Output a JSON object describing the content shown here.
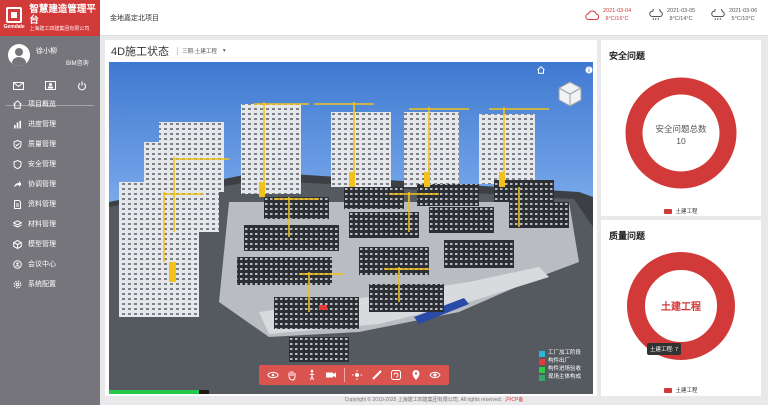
{
  "brand": {
    "title": "智慧建造管理平台",
    "subtitle": "上海建工四建集团有限公司",
    "logo_text": "Gemdale"
  },
  "user": {
    "name": "徐小柳",
    "role": "BIM咨询"
  },
  "nav": [
    {
      "label": "项目概览",
      "icon": "home-icon"
    },
    {
      "label": "进度管理",
      "icon": "bar-chart-icon"
    },
    {
      "label": "质量管理",
      "icon": "shield-check-icon"
    },
    {
      "label": "安全管理",
      "icon": "shield-icon"
    },
    {
      "label": "协调管理",
      "icon": "share-arrow-icon"
    },
    {
      "label": "资料管理",
      "icon": "document-icon"
    },
    {
      "label": "材料管理",
      "icon": "layers-icon"
    },
    {
      "label": "模型管理",
      "icon": "cube-icon"
    },
    {
      "label": "会议中心",
      "icon": "meeting-icon"
    },
    {
      "label": "系统配置",
      "icon": "settings-icon"
    }
  ],
  "header": {
    "project_name": "金地嘉定北项目",
    "weather": [
      {
        "date": "2021-03-04",
        "temp": "8°C/16°C",
        "icon": "cloud-icon",
        "highlight": true
      },
      {
        "date": "2021-03-05",
        "temp": "8°C/14°C",
        "icon": "rain-cloud-icon",
        "highlight": false
      },
      {
        "date": "2021-03-06",
        "temp": "5°C/10°C",
        "icon": "rain-cloud-icon",
        "highlight": false
      }
    ]
  },
  "main": {
    "title": "4D施工状态",
    "selected_phase": "三期-土建工程",
    "legend": [
      {
        "label": "工厂加工阶段",
        "color": "#29b6d8"
      },
      {
        "label": "构件出厂",
        "color": "#e23b3b"
      },
      {
        "label": "构件进场验收",
        "color": "#2ecc40"
      },
      {
        "label": "现场主体构成",
        "color": "#2fa86c"
      }
    ],
    "progress": 0.9
  },
  "safety": {
    "title": "安全问题",
    "center_label": "安全问题总数",
    "center_value": "10",
    "legend": "土建工程"
  },
  "quality": {
    "title": "质量问题",
    "center_label": "土建工程",
    "tooltip": "土建工程: 7",
    "legend": "土建工程"
  },
  "footer": {
    "copyright": "Copyright © 2019-2025 上海建工四建集团有限公司. All rights reserved.",
    "icp": "沪ICP备"
  },
  "colors": {
    "brand_red": "#d23a3a",
    "sidebar": "#75757b",
    "sky_blue": "#5b8ede"
  }
}
